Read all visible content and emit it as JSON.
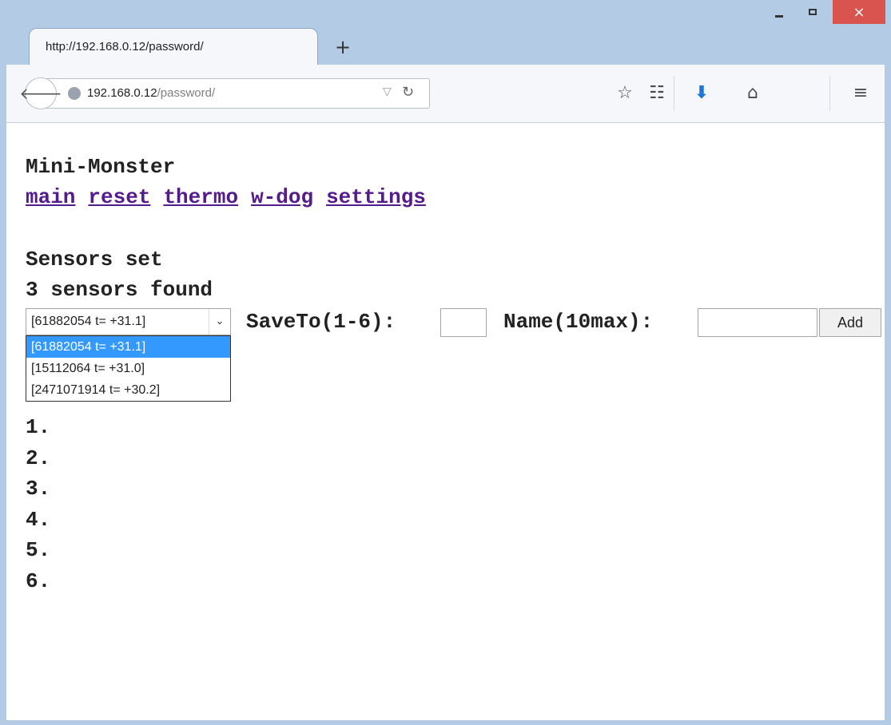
{
  "browser": {
    "tab_title": "http://192.168.0.12/password/",
    "new_tab_symbol": "+",
    "url_host": "192.168.0.12",
    "url_path": "/password/",
    "window_controls": {
      "close_symbol": "×"
    }
  },
  "page": {
    "title": "Mini-Monster",
    "nav": [
      "main",
      "reset",
      "thermo",
      "w-dog",
      "settings"
    ],
    "section_heading": "Sensors set",
    "sensors_status": "3 sensors found",
    "form": {
      "selected_sensor": "[61882054 t= +31.1]",
      "save_label": "SaveTo(1-6):",
      "save_value": "",
      "name_label": "Name(10max):",
      "name_value": "",
      "add_label": "Add"
    },
    "sensor_options": [
      "[61882054 t= +31.1]",
      "[15112064 t= +31.0]",
      "[2471071914 t= +30.2]"
    ],
    "selected_option_index": 0,
    "slots": [
      "1.",
      "2.",
      "3.",
      "4.",
      "5.",
      "6."
    ]
  },
  "colors": {
    "link": "#551a8b",
    "selection": "#3399ff",
    "close_button": "#d9534f",
    "download_icon": "#1e77d8"
  },
  "icons": [
    "back-arrow-icon",
    "globe-icon",
    "dropmarker-icon",
    "reload-icon",
    "star-icon",
    "reading-list-icon",
    "download-icon",
    "home-icon",
    "menu-icon",
    "minimize-icon",
    "maximize-icon",
    "close-icon"
  ]
}
